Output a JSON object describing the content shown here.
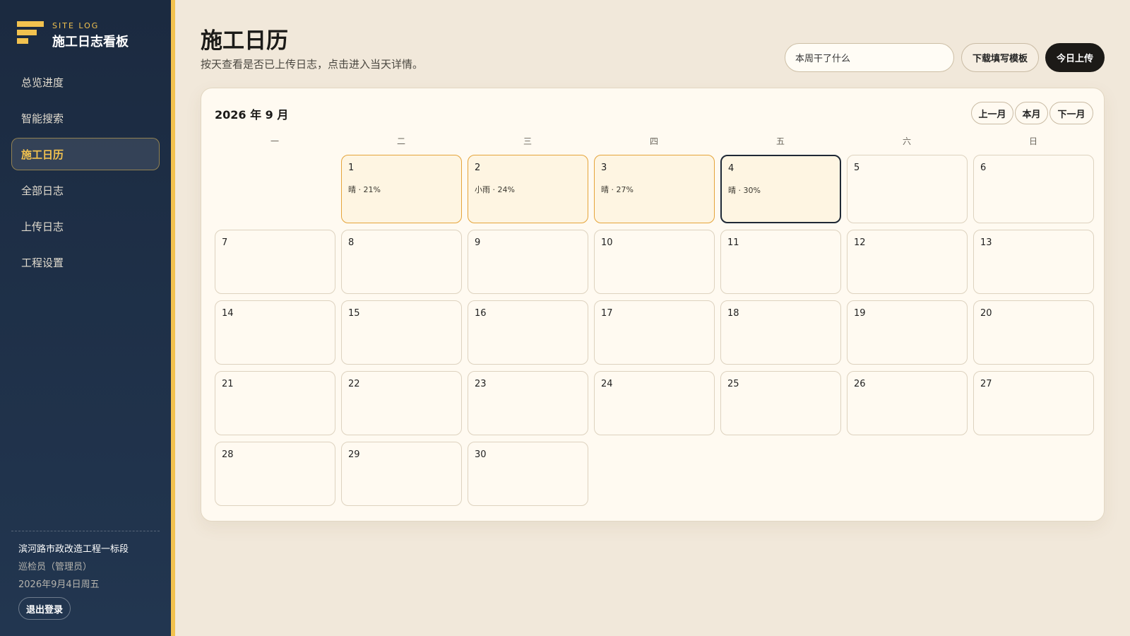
{
  "brand": {
    "subtitle": "SITE LOG",
    "title": "施工日志看板"
  },
  "nav": {
    "items": [
      {
        "label": "总览进度",
        "active": false
      },
      {
        "label": "智能搜索",
        "active": false
      },
      {
        "label": "施工日历",
        "active": true
      },
      {
        "label": "全部日志",
        "active": false
      },
      {
        "label": "上传日志",
        "active": false
      },
      {
        "label": "工程设置",
        "active": false
      }
    ]
  },
  "footer": {
    "project": "滨河路市政改造工程一标段",
    "role": "巡检员（管理员）",
    "date": "2026年9月4日周五",
    "logout_label": "退出登录"
  },
  "header": {
    "title": "施工日历",
    "subtitle": "按天查看是否已上传日志，点击进入当天详情。",
    "search_value": "本周干了什么",
    "template_label": "下载填写模板",
    "upload_label": "今日上传"
  },
  "calendar": {
    "month_label": "2026 年 9 月",
    "prev_label": "上一月",
    "current_label": "本月",
    "next_label": "下一月",
    "weekdays": [
      "一",
      "二",
      "三",
      "四",
      "五",
      "六",
      "日"
    ],
    "first_weekday_index": 1,
    "days_in_month": 30,
    "today": 4,
    "logs": {
      "1": "晴 · 21%",
      "2": "小雨 · 24%",
      "3": "晴 · 27%",
      "4": "晴 · 30%"
    }
  },
  "colors": {
    "sidebar": "#1b2a40",
    "accent": "#f2c24f",
    "logged_border": "#e5a43a",
    "logged_bg": "#fef5e2",
    "today_border": "#1f2936"
  }
}
